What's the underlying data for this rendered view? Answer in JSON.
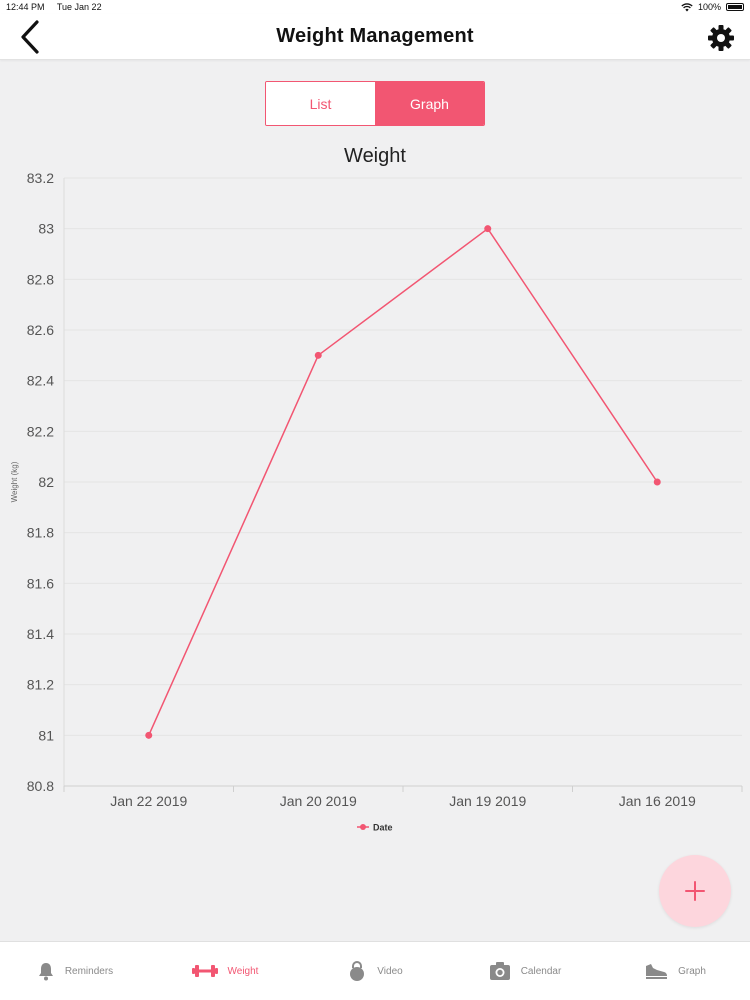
{
  "status_bar": {
    "time": "12:44 PM",
    "date": "Tue Jan 22",
    "battery": "100%"
  },
  "nav": {
    "title": "Weight Management",
    "back_icon": "chevron-left-icon",
    "settings_icon": "gear-icon"
  },
  "segments": {
    "list_label": "List",
    "graph_label": "Graph",
    "selected": "Graph"
  },
  "colors": {
    "accent": "#f25672",
    "fab_bg": "#fdd6dd",
    "tab_inactive": "#8a8a8a"
  },
  "chart_data": {
    "type": "line",
    "title": "Weight",
    "ylabel": "Weight (kg)",
    "xlabel": "",
    "categories": [
      "Jan 22 2019",
      "Jan 20 2019",
      "Jan 19 2019",
      "Jan 16 2019"
    ],
    "series": [
      {
        "name": "Date",
        "values": [
          81,
          82.5,
          83,
          82
        ]
      }
    ],
    "ylim": [
      80.8,
      83.2
    ],
    "yticks": [
      "83.2",
      "83",
      "82.8",
      "82.6",
      "82.4",
      "82.2",
      "82",
      "81.8",
      "81.6",
      "81.4",
      "81.2",
      "81",
      "80.8"
    ],
    "grid": true,
    "legend": "bottom-center"
  },
  "fab": {
    "icon": "plus-icon"
  },
  "tabs": [
    {
      "label": "Reminders",
      "icon": "bell-icon",
      "active": false
    },
    {
      "label": "Weight",
      "icon": "dumbbell-icon",
      "active": true
    },
    {
      "label": "Video",
      "icon": "kettlebell-icon",
      "active": false
    },
    {
      "label": "Calendar",
      "icon": "camera-icon",
      "active": false
    },
    {
      "label": "Graph",
      "icon": "shoe-icon",
      "active": false
    }
  ]
}
